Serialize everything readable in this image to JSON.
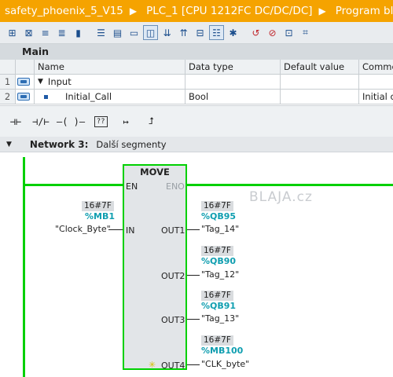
{
  "breadcrumb": {
    "items": [
      "safety_phoenix_5_V15",
      "PLC_1 [CPU 1212FC DC/DC/DC]",
      "Program blocks"
    ],
    "separator": "▶"
  },
  "toolbar": {
    "icons": [
      "connect-icon",
      "disconnect-icon",
      "monitor-icon",
      "monitor-all-icon",
      "download-icon",
      "insert-network-icon",
      "delete-network-icon",
      "comments-icon",
      "symbol-info-icon",
      "open-all-icon",
      "close-all-icon",
      "insert-row-icon",
      "absolute-operands-icon",
      "favorites-icon",
      "call-icon",
      "stop-icon",
      "go-to-icon",
      "navigation-icon"
    ]
  },
  "interface": {
    "section_title": "Main",
    "columns": [
      "",
      "Name",
      "Data type",
      "Default value",
      "Comment"
    ],
    "rows": [
      {
        "num": "1",
        "name": "Input",
        "type": "",
        "default": "",
        "comment": ""
      },
      {
        "num": "2",
        "name": "Initial_Call",
        "type": "Bool",
        "default": "",
        "comment": "Initial c"
      }
    ]
  },
  "lad_toolbar": {
    "items": [
      "⊣⊢",
      "⊣/⊢",
      "–( )–",
      "??",
      "↦",
      "⮥"
    ]
  },
  "network": {
    "label": "Network 3:",
    "comment": "Další segmenty"
  },
  "block": {
    "name": "MOVE",
    "en": "EN",
    "eno": "ENO",
    "in_pin": "IN",
    "input": {
      "value": "16#7F",
      "address": "%MB1",
      "tag": "\"Clock_Byte\""
    },
    "outputs": [
      {
        "pin": "OUT1",
        "value": "16#7F",
        "address": "%QB95",
        "tag": "\"Tag_14\""
      },
      {
        "pin": "OUT2",
        "value": "16#7F",
        "address": "%QB90",
        "tag": "\"Tag_12\""
      },
      {
        "pin": "OUT3",
        "value": "16#7F",
        "address": "%QB91",
        "tag": "\"Tag_13\""
      },
      {
        "pin": "OUT4",
        "value": "16#7F",
        "address": "%MB100",
        "tag": "\"CLK_byte\""
      }
    ]
  },
  "watermark": "BLAJA.cz",
  "colors": {
    "breadcrumb_bg": "#f5a300",
    "powerflow": "#00d000",
    "address": "#0f9eb0",
    "block_bg": "#e2e5e8"
  }
}
